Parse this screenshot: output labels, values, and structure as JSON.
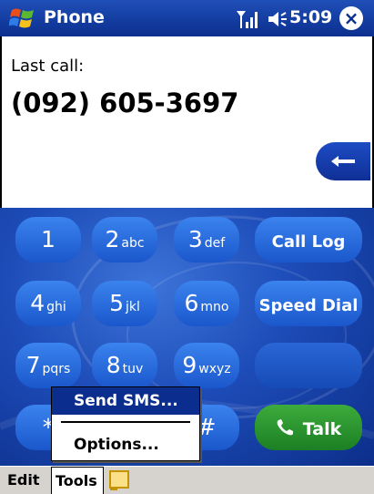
{
  "titlebar": {
    "app_title": "Phone",
    "time": "5:09",
    "close_label": "×",
    "icons": [
      "windows-start-icon",
      "signal-icon",
      "speaker-icon",
      "close-icon"
    ]
  },
  "display": {
    "last_call_label": "Last call:",
    "last_call_number": "(092) 605-3697",
    "backspace_icon": "backspace-arrow-icon"
  },
  "keypad": {
    "keys": [
      {
        "digit": "1",
        "letters": ""
      },
      {
        "digit": "2",
        "letters": "abc"
      },
      {
        "digit": "3",
        "letters": "def"
      },
      {
        "digit": "4",
        "letters": "ghi"
      },
      {
        "digit": "5",
        "letters": "jkl"
      },
      {
        "digit": "6",
        "letters": "mno"
      },
      {
        "digit": "7",
        "letters": "pqrs"
      },
      {
        "digit": "8",
        "letters": "tuv"
      },
      {
        "digit": "9",
        "letters": "wxyz"
      },
      {
        "digit": "*",
        "letters": ""
      },
      {
        "digit": "#",
        "letters": ""
      }
    ],
    "call_log": "Call Log",
    "speed_dial": "Speed Dial",
    "talk": "Talk"
  },
  "menu": {
    "send_sms": "Send SMS...",
    "options": "Options..."
  },
  "menubar": {
    "edit": "Edit",
    "tools": "Tools"
  },
  "colors": {
    "titlebar": "#0b2f8e",
    "key_blue": "#1a57cc",
    "talk_green": "#1c7f24",
    "menu_highlight": "#0a2d8e",
    "menubar": "#d6d3ce"
  }
}
